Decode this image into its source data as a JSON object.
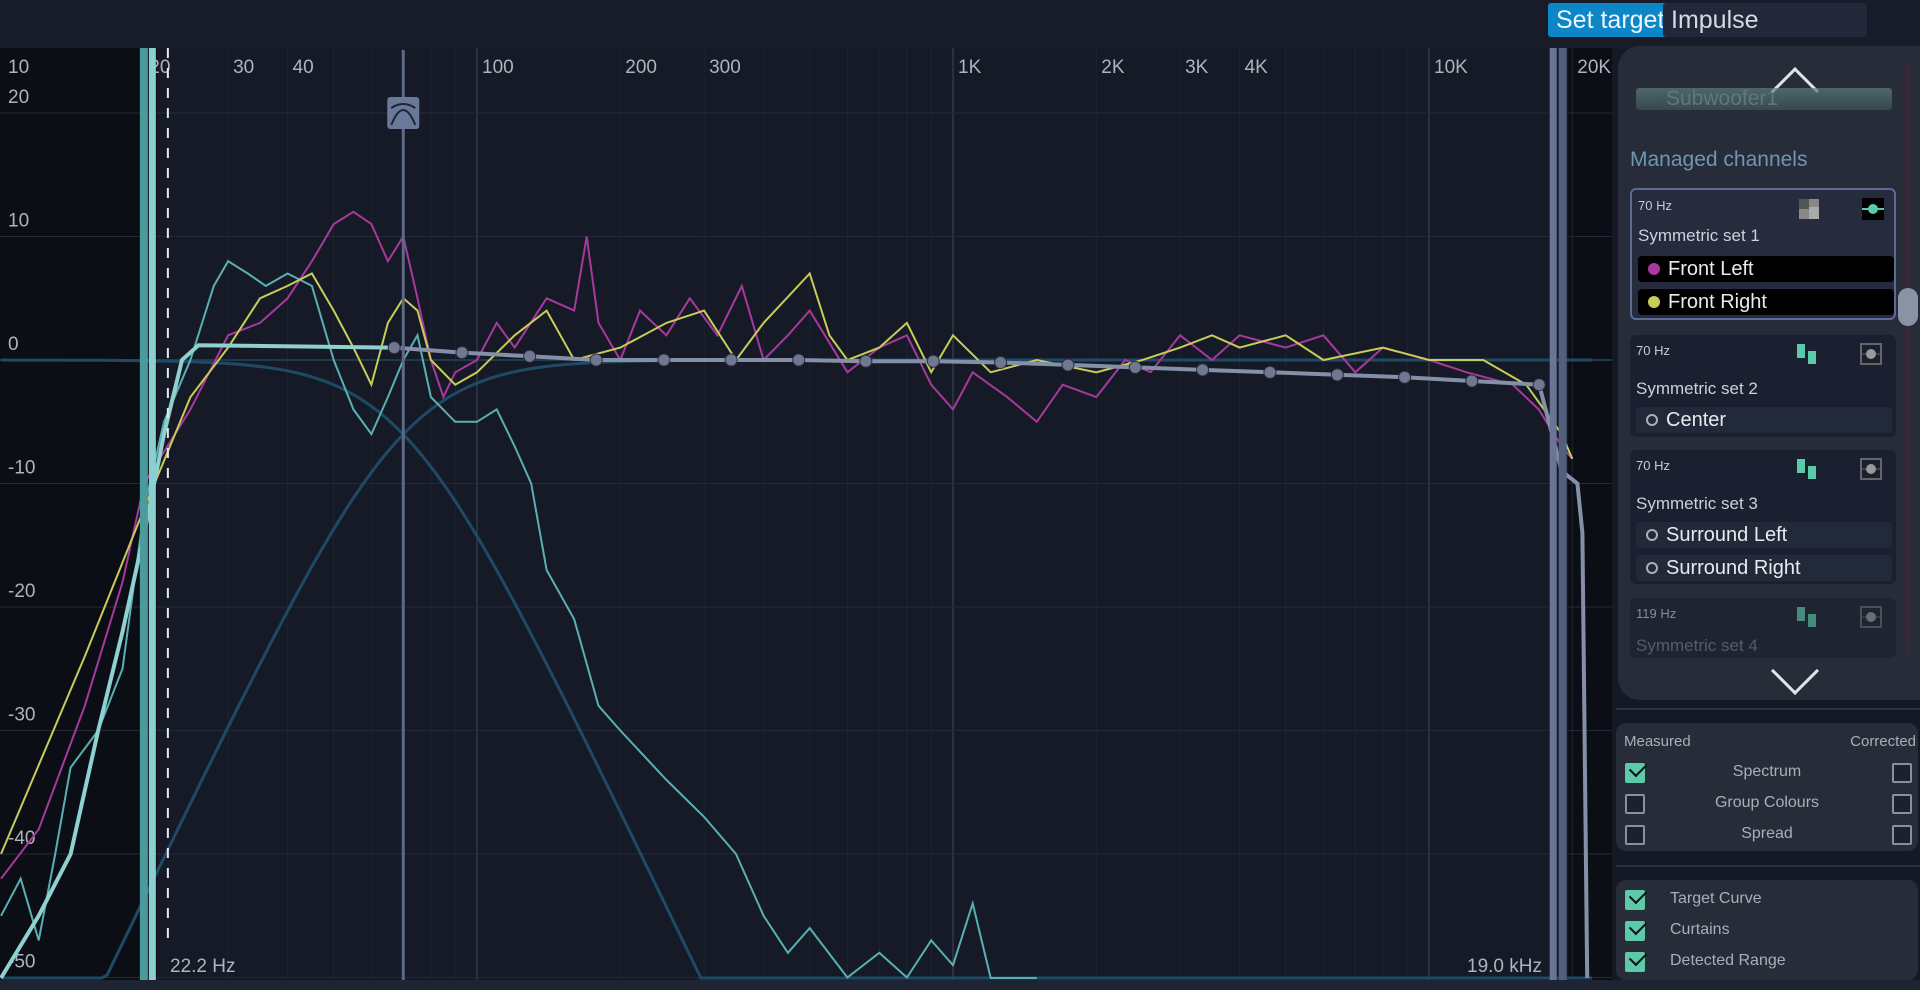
{
  "tabs": {
    "set_target": "Set target",
    "impulse_response": "Impulse response"
  },
  "colors": {
    "accent": "#0d86c8",
    "front_left": "#a8399c",
    "front_right": "#c7cd58",
    "subwoofer": "#58b0b4",
    "target": "#8490a8",
    "check": "#5cc9a8"
  },
  "panel": {
    "faded_top_item": "Subwoofer1",
    "section_title": "Managed channels",
    "sets": [
      {
        "crossover": "70 Hz",
        "name": "Symmetric set 1",
        "channels": [
          "Front Left",
          "Front Right"
        ]
      },
      {
        "crossover": "70 Hz",
        "name": "Symmetric set 2",
        "channels": [
          "Center"
        ]
      },
      {
        "crossover": "70 Hz",
        "name": "Symmetric set 3",
        "channels": [
          "Surround Left",
          "Surround Right"
        ]
      },
      {
        "crossover": "119 Hz",
        "name": "Symmetric set 4",
        "channels": []
      }
    ]
  },
  "display": {
    "measured": "Measured",
    "corrected": "Corrected",
    "rows": [
      {
        "label": "Spectrum",
        "measured": true,
        "corrected": false
      },
      {
        "label": "Group Colours",
        "measured": false,
        "corrected": false
      },
      {
        "label": "Spread",
        "measured": false,
        "corrected": false
      }
    ],
    "overlays": [
      {
        "label": "Target Curve",
        "checked": true
      },
      {
        "label": "Curtains",
        "checked": true
      },
      {
        "label": "Detected Range",
        "checked": true
      }
    ]
  },
  "chart_data": {
    "type": "line",
    "xscale": "log",
    "xlim": [
      10,
      22000
    ],
    "ylim": [
      -52,
      22
    ],
    "x_ticks": [
      {
        "v": 10,
        "t": "10"
      },
      {
        "v": 20,
        "t": "20"
      },
      {
        "v": 30,
        "t": "30"
      },
      {
        "v": 40,
        "t": "40"
      },
      {
        "v": 100,
        "t": "100"
      },
      {
        "v": 200,
        "t": "200"
      },
      {
        "v": 300,
        "t": "300"
      },
      {
        "v": 1000,
        "t": "1K"
      },
      {
        "v": 2000,
        "t": "2K"
      },
      {
        "v": 3000,
        "t": "3K"
      },
      {
        "v": 4000,
        "t": "4K"
      },
      {
        "v": 10000,
        "t": "10K"
      },
      {
        "v": 20000,
        "t": "20K"
      }
    ],
    "y_ticks": [
      20,
      10,
      0,
      -10,
      -20,
      -30,
      -40,
      -50
    ],
    "curtain_low": {
      "freq": 22.2,
      "label": "22.2 Hz"
    },
    "curtain_high": {
      "freq": 19000,
      "label": "19.0 kHz"
    },
    "crossover_hz": 70,
    "series": {
      "front_left": [
        [
          10,
          -42
        ],
        [
          12,
          -38
        ],
        [
          15,
          -28
        ],
        [
          18,
          -18
        ],
        [
          20,
          -10
        ],
        [
          25,
          -4
        ],
        [
          30,
          2
        ],
        [
          35,
          3
        ],
        [
          40,
          5
        ],
        [
          45,
          8
        ],
        [
          50,
          11
        ],
        [
          55,
          12
        ],
        [
          60,
          11
        ],
        [
          65,
          8
        ],
        [
          70,
          10
        ],
        [
          75,
          5
        ],
        [
          80,
          0
        ],
        [
          85,
          -3
        ],
        [
          90,
          -1
        ],
        [
          100,
          0
        ],
        [
          110,
          3
        ],
        [
          120,
          1
        ],
        [
          140,
          5
        ],
        [
          160,
          4
        ],
        [
          170,
          10
        ],
        [
          180,
          3
        ],
        [
          200,
          0
        ],
        [
          220,
          4
        ],
        [
          250,
          2
        ],
        [
          280,
          5
        ],
        [
          320,
          2
        ],
        [
          360,
          6
        ],
        [
          400,
          0
        ],
        [
          450,
          2
        ],
        [
          500,
          4
        ],
        [
          600,
          -1
        ],
        [
          700,
          1
        ],
        [
          800,
          2
        ],
        [
          900,
          -2
        ],
        [
          1000,
          -4
        ],
        [
          1100,
          -1
        ],
        [
          1300,
          -3
        ],
        [
          1500,
          -5
        ],
        [
          1700,
          -2
        ],
        [
          2000,
          -3
        ],
        [
          2300,
          0
        ],
        [
          2600,
          -1
        ],
        [
          3000,
          2
        ],
        [
          3500,
          0
        ],
        [
          4000,
          2
        ],
        [
          5000,
          1
        ],
        [
          6000,
          2
        ],
        [
          7000,
          -1
        ],
        [
          8000,
          1
        ],
        [
          10000,
          0
        ],
        [
          12000,
          -1
        ],
        [
          15000,
          -2
        ],
        [
          17000,
          -4
        ],
        [
          19000,
          -7
        ],
        [
          20000,
          -8
        ]
      ],
      "front_right": [
        [
          10,
          -40
        ],
        [
          15,
          -24
        ],
        [
          20,
          -12
        ],
        [
          25,
          -3
        ],
        [
          30,
          1
        ],
        [
          35,
          5
        ],
        [
          40,
          6
        ],
        [
          45,
          7
        ],
        [
          50,
          4
        ],
        [
          55,
          1
        ],
        [
          60,
          -2
        ],
        [
          65,
          3
        ],
        [
          70,
          5
        ],
        [
          75,
          4
        ],
        [
          80,
          0
        ],
        [
          90,
          -2
        ],
        [
          100,
          -1
        ],
        [
          120,
          2
        ],
        [
          140,
          4
        ],
        [
          160,
          0
        ],
        [
          200,
          1
        ],
        [
          250,
          3
        ],
        [
          300,
          4
        ],
        [
          350,
          0
        ],
        [
          400,
          3
        ],
        [
          500,
          7
        ],
        [
          550,
          2
        ],
        [
          600,
          0
        ],
        [
          700,
          1
        ],
        [
          800,
          3
        ],
        [
          900,
          -1
        ],
        [
          1000,
          2
        ],
        [
          1200,
          -1
        ],
        [
          1500,
          0
        ],
        [
          2000,
          -1
        ],
        [
          2500,
          0
        ],
        [
          3000,
          1
        ],
        [
          3500,
          2
        ],
        [
          4000,
          1
        ],
        [
          5000,
          2
        ],
        [
          6000,
          0
        ],
        [
          8000,
          1
        ],
        [
          10000,
          0
        ],
        [
          13000,
          0
        ],
        [
          16000,
          -2
        ],
        [
          19000,
          -6
        ],
        [
          20000,
          -8
        ]
      ],
      "subwoofer": [
        [
          10,
          -45
        ],
        [
          11,
          -42
        ],
        [
          12,
          -47
        ],
        [
          13,
          -40
        ],
        [
          14,
          -33
        ],
        [
          16,
          -30
        ],
        [
          18,
          -25
        ],
        [
          20,
          -12
        ],
        [
          22,
          -5
        ],
        [
          25,
          0
        ],
        [
          28,
          6
        ],
        [
          30,
          8
        ],
        [
          33,
          7
        ],
        [
          36,
          6
        ],
        [
          40,
          7
        ],
        [
          45,
          6
        ],
        [
          50,
          0
        ],
        [
          55,
          -4
        ],
        [
          60,
          -6
        ],
        [
          65,
          -3
        ],
        [
          70,
          0
        ],
        [
          75,
          2
        ],
        [
          80,
          -3
        ],
        [
          90,
          -5
        ],
        [
          100,
          -5
        ],
        [
          110,
          -4
        ],
        [
          120,
          -7
        ],
        [
          130,
          -10
        ],
        [
          140,
          -17
        ],
        [
          160,
          -21
        ],
        [
          180,
          -28
        ],
        [
          200,
          -30
        ],
        [
          250,
          -34
        ],
        [
          300,
          -37
        ],
        [
          350,
          -40
        ],
        [
          400,
          -45
        ],
        [
          450,
          -48
        ],
        [
          500,
          -46
        ],
        [
          600,
          -50
        ],
        [
          700,
          -48
        ],
        [
          800,
          -50
        ],
        [
          900,
          -47
        ],
        [
          1000,
          -49
        ],
        [
          1100,
          -44
        ],
        [
          1200,
          -51
        ],
        [
          1500,
          -52
        ]
      ],
      "low_target": [
        [
          10,
          -52
        ],
        [
          12,
          -45
        ],
        [
          14,
          -40
        ],
        [
          16,
          -30
        ],
        [
          18,
          -22
        ],
        [
          20,
          -14
        ],
        [
          22,
          -6
        ],
        [
          24,
          0
        ],
        [
          26,
          1.2
        ],
        [
          67,
          1
        ]
      ],
      "target_nodes": [
        [
          67,
          1
        ],
        [
          93,
          0.6
        ],
        [
          129,
          0.3
        ],
        [
          178,
          0
        ],
        [
          247,
          0
        ],
        [
          342,
          0
        ],
        [
          474,
          0
        ],
        [
          656,
          -0.1
        ],
        [
          909,
          -0.1
        ],
        [
          1259,
          -0.2
        ],
        [
          1744,
          -0.4
        ],
        [
          2415,
          -0.6
        ],
        [
          3345,
          -0.8
        ],
        [
          4633,
          -1
        ],
        [
          6417,
          -1.2
        ],
        [
          8887,
          -1.4
        ],
        [
          12300,
          -1.7
        ],
        [
          17040,
          -2
        ]
      ],
      "target_tail": [
        [
          17040,
          -2
        ],
        [
          19000,
          -9
        ],
        [
          20500,
          -10
        ],
        [
          21000,
          -14
        ],
        [
          21500,
          -52
        ]
      ]
    }
  }
}
